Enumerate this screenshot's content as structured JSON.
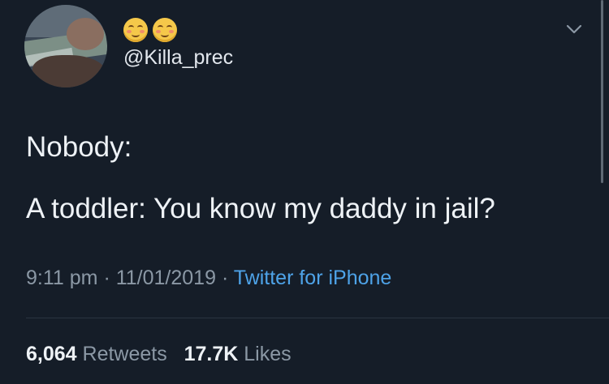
{
  "user": {
    "display_name_icons": [
      "smiling-face-icon",
      "smiling-face-icon"
    ],
    "handle": "@Killa_prec"
  },
  "tweet": {
    "line1": "Nobody:",
    "line2": "A toddler: You know my daddy in jail?",
    "time": "9:11 pm",
    "separator": "·",
    "date": "11/01/2019",
    "source": "Twitter for iPhone"
  },
  "stats": {
    "retweets_count": "6,064",
    "retweets_label": "Retweets",
    "likes_count": "17.7K",
    "likes_label": "Likes"
  },
  "colors": {
    "background": "#151d28",
    "link": "#4ea3e8",
    "muted": "#8b98a5"
  }
}
